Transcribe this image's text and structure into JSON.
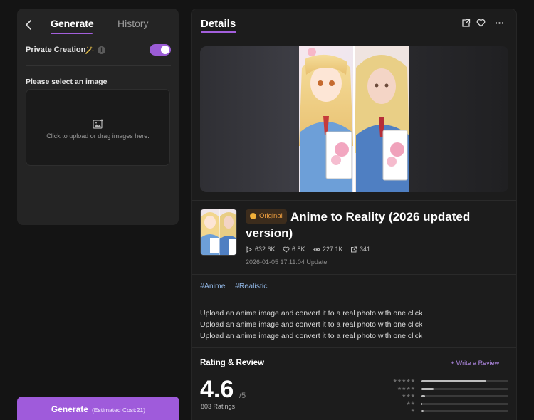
{
  "left_panel": {
    "tabs": [
      {
        "label": "Generate",
        "active": true
      },
      {
        "label": "History",
        "active": false
      }
    ],
    "private_creation": {
      "label": "Private Creation",
      "enabled": true
    },
    "select_image_label": "Please select an image",
    "upload_text": "Click to upload or drag images here."
  },
  "generate_button": {
    "label": "Generate",
    "cost": "(Estimated Cost:21)"
  },
  "details": {
    "header_title": "Details",
    "header_icons": [
      "external-link-icon",
      "heart-icon",
      "more-icon"
    ],
    "badge": "Original",
    "title": "Anime to Reality  (2026 updated version)",
    "stats": {
      "plays": "632.6K",
      "likes": "6.8K",
      "views": "227.1K",
      "shares": "341"
    },
    "update_time": "2026-01-05 17:11:04 Update",
    "tags": [
      "#Anime",
      "#Realistic"
    ],
    "description": [
      "Upload an anime image and convert it to a real photo with one click",
      "Upload an anime image and convert it to a real photo with one click",
      "Upload an anime image and convert it to a real photo with one click"
    ]
  },
  "rating": {
    "title": "Rating & Review",
    "write_review": "+ Write a Review",
    "score": "4.6",
    "max": "/5",
    "count": "803 Ratings",
    "distribution": [
      {
        "stars": 5,
        "fraction": 0.75
      },
      {
        "stars": 4,
        "fraction": 0.15
      },
      {
        "stars": 3,
        "fraction": 0.05
      },
      {
        "stars": 2,
        "fraction": 0.02
      },
      {
        "stars": 1,
        "fraction": 0.03
      }
    ]
  },
  "colors": {
    "accent": "#a35fdc",
    "badge_text": "#f0a040",
    "tag_text": "#8fb4e2"
  }
}
